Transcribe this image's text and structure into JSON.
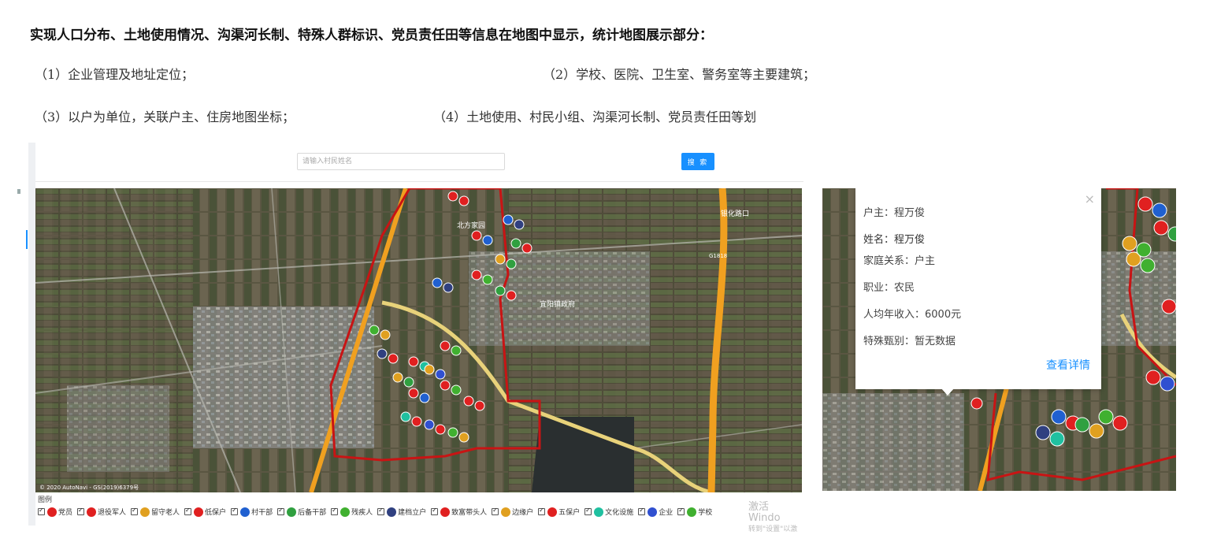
{
  "heading": "实现人口分布、土地使用情况、沟渠河长制、特殊人群标识、党员责任田等信息在地图中显示，统计地图展示部分：",
  "requirements": [
    "（1）企业管理及地址定位；",
    "（2）学校、医院、卫生室、警务室等主要建筑；",
    "（3）以户为单位，关联户主、住房地图坐标；",
    "（4）土地使用、村民小组、沟渠河长制、党员责任田等划"
  ],
  "search": {
    "placeholder": "请输入村民姓名",
    "button_label": "搜 索"
  },
  "map": {
    "copyright": "© 2020 AutoNavi - GS(2019)6379号",
    "roads": [
      "G1818",
      "G1818"
    ],
    "place_labels": [
      "北方家园",
      "宜阳镇政府",
      "银化路口"
    ]
  },
  "legend": {
    "title": "图例",
    "items": [
      {
        "label": "党员",
        "color": "#e02020"
      },
      {
        "label": "退役军人",
        "color": "#e02020"
      },
      {
        "label": "留守老人",
        "color": "#e0a020"
      },
      {
        "label": "低保户",
        "color": "#e02020"
      },
      {
        "label": "村干部",
        "color": "#2060d0"
      },
      {
        "label": "后备干部",
        "color": "#30a040"
      },
      {
        "label": "残疾人",
        "color": "#40b030"
      },
      {
        "label": "建档立户",
        "color": "#304080"
      },
      {
        "label": "致富带头人",
        "color": "#e02020"
      },
      {
        "label": "边缘户",
        "color": "#e0a020"
      },
      {
        "label": "五保户",
        "color": "#e02020"
      },
      {
        "label": "文化设施",
        "color": "#20c0a0"
      },
      {
        "label": "企业",
        "color": "#3050d0"
      },
      {
        "label": "学校",
        "color": "#40b030"
      }
    ]
  },
  "watermark": {
    "line1": "激活 Windo",
    "line2": "转到\"设置\"以激"
  },
  "popup": {
    "householder": "户主：程万俊",
    "name": "姓名：程万俊",
    "relation": "家庭关系：户主",
    "occupation": "职业：农民",
    "income": "人均年收入：6000元",
    "special": "特殊甄别：暂无数据",
    "detail_link": "查看详情",
    "close": "×"
  },
  "colors": {
    "boundary": "#c81414",
    "highway": "#f0a020",
    "road_light": "#e8d27a",
    "button": "#1890ff"
  }
}
